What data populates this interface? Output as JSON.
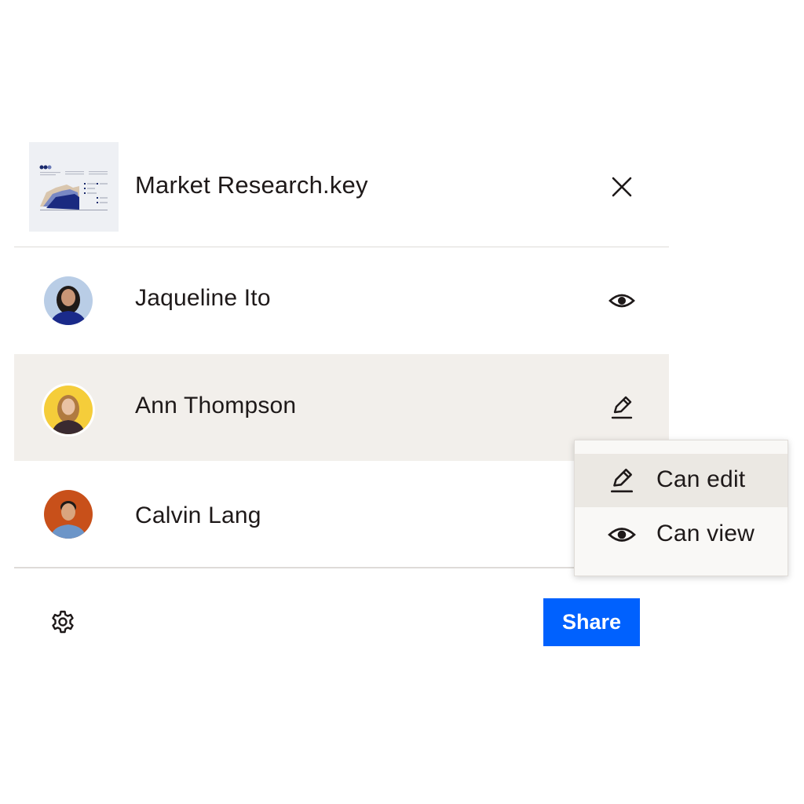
{
  "file": {
    "name": "Market Research.key",
    "close_icon": "close-icon"
  },
  "members": [
    {
      "name": "Jaqueline Ito",
      "permission_icon": "eye-icon",
      "avatar_bg": "#b9cde6"
    },
    {
      "name": "Ann Thompson",
      "permission_icon": "pencil-icon",
      "avatar_bg": "#f5cd3a"
    },
    {
      "name": "Calvin Lang",
      "permission_icon": "none",
      "avatar_bg": "#c8501a"
    }
  ],
  "permission_menu": {
    "items": [
      {
        "label": "Can edit",
        "icon": "pencil-icon"
      },
      {
        "label": "Can view",
        "icon": "eye-icon"
      }
    ]
  },
  "footer": {
    "settings_icon": "gear-icon",
    "share_label": "Share"
  },
  "colors": {
    "accent": "#0061fe",
    "selected_row": "#f2efeb",
    "text": "#1e1919"
  }
}
